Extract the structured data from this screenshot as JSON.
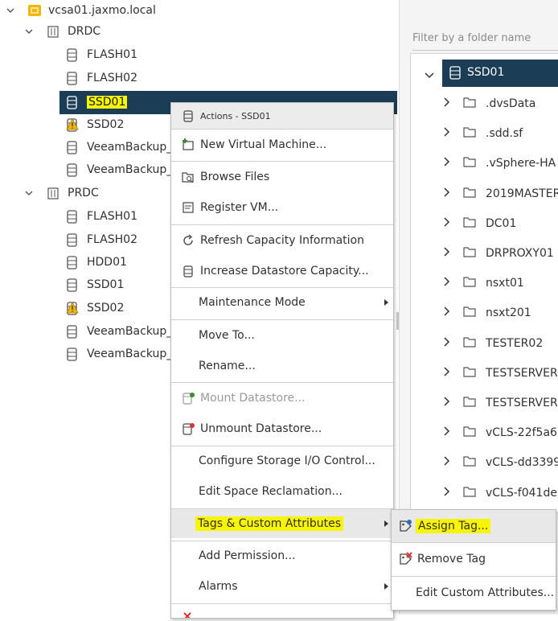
{
  "tree": {
    "vcenter": "vcsa01.jaxmo.local",
    "datacenters": [
      {
        "name": "DRDC",
        "items": [
          "FLASH01",
          "FLASH02",
          "SSD01",
          "SSD02",
          "VeeamBackup_",
          "VeeamBackup_"
        ]
      },
      {
        "name": "PRDC",
        "items": [
          "FLASH01",
          "FLASH02",
          "HDD01",
          "SSD01",
          "SSD02",
          "VeeamBackup_",
          "VeeamBackup_"
        ]
      }
    ]
  },
  "filter": {
    "placeholder": "Filter by a folder name"
  },
  "files": {
    "root": "SSD01",
    "folders": [
      ".dvsData",
      ".sdd.sf",
      ".vSphere-HA",
      "2019MASTER",
      "DC01",
      "DRPROXY01",
      "nsxt01",
      "nsxt201",
      "TESTER02",
      "TESTSERVER",
      "TESTSERVER",
      "vCLS-22f5a6",
      "vCLS-dd3399",
      "vCLS-f041de"
    ]
  },
  "context_menu": {
    "header": "Actions - SSD01",
    "items": {
      "new_vm": "New Virtual Machine...",
      "browse": "Browse Files",
      "register": "Register VM...",
      "refresh": "Refresh Capacity Information",
      "increase": "Increase Datastore Capacity...",
      "maintenance": "Maintenance Mode",
      "move": "Move To...",
      "rename": "Rename...",
      "mount": "Mount Datastore...",
      "unmount": "Unmount Datastore...",
      "storage_io": "Configure Storage I/O Control...",
      "space_reclaim": "Edit Space Reclamation...",
      "tags": "Tags & Custom Attributes",
      "permission": "Add Permission...",
      "alarms": "Alarms"
    }
  },
  "submenu": {
    "assign": "Assign Tag...",
    "remove": "Remove Tag",
    "edit": "Edit Custom Attributes..."
  },
  "colors": {
    "selection": "#1b3d55",
    "highlight": "#f7f500",
    "warning": "#f2b500",
    "error": "#d6322e",
    "success": "#3c8a2e"
  }
}
